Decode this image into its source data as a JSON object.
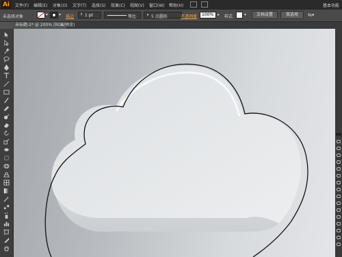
{
  "app": {
    "logo": "Ai",
    "workspace": "基本功能"
  },
  "menu": [
    "文件(F)",
    "编辑(E)",
    "对象(O)",
    "文字(T)",
    "选择(S)",
    "效果(C)",
    "视图(V)",
    "窗口(W)",
    "帮助(H)"
  ],
  "control": {
    "selection_label": "未选择对象",
    "stroke_label": "描边",
    "stroke_value": "1 pt",
    "profile_label": "等比",
    "brush_value": "5 点圆形",
    "opacity_label": "不透明度",
    "opacity_value": "100%",
    "style_label": "样式",
    "doc_settings": "文档设置",
    "preferences": "首选项"
  },
  "document": {
    "tab_title": "未标题-2* @ 200% (RGB/预览)",
    "close": "×"
  },
  "tools": [
    "selection-tool",
    "direct-selection-tool",
    "magic-wand-tool",
    "lasso-tool",
    "pen-tool",
    "type-tool",
    "line-tool",
    "rectangle-tool",
    "paintbrush-tool",
    "pencil-tool",
    "blob-brush-tool",
    "eraser-tool",
    "rotate-tool",
    "scale-tool",
    "width-tool",
    "free-transform-tool",
    "shape-builder-tool",
    "perspective-grid-tool",
    "mesh-tool",
    "gradient-tool",
    "eyedropper-tool",
    "blend-tool",
    "symbol-sprayer-tool",
    "column-graph-tool",
    "artboard-tool",
    "slice-tool",
    "hand-tool",
    "zoom-tool"
  ],
  "colors": {
    "accent": "#f3a43b",
    "menubar": "#2a2a2a",
    "panel": "#4a4a4a",
    "canvas_light": "#e3e5e8",
    "canvas_dark": "#a3a7ab"
  }
}
